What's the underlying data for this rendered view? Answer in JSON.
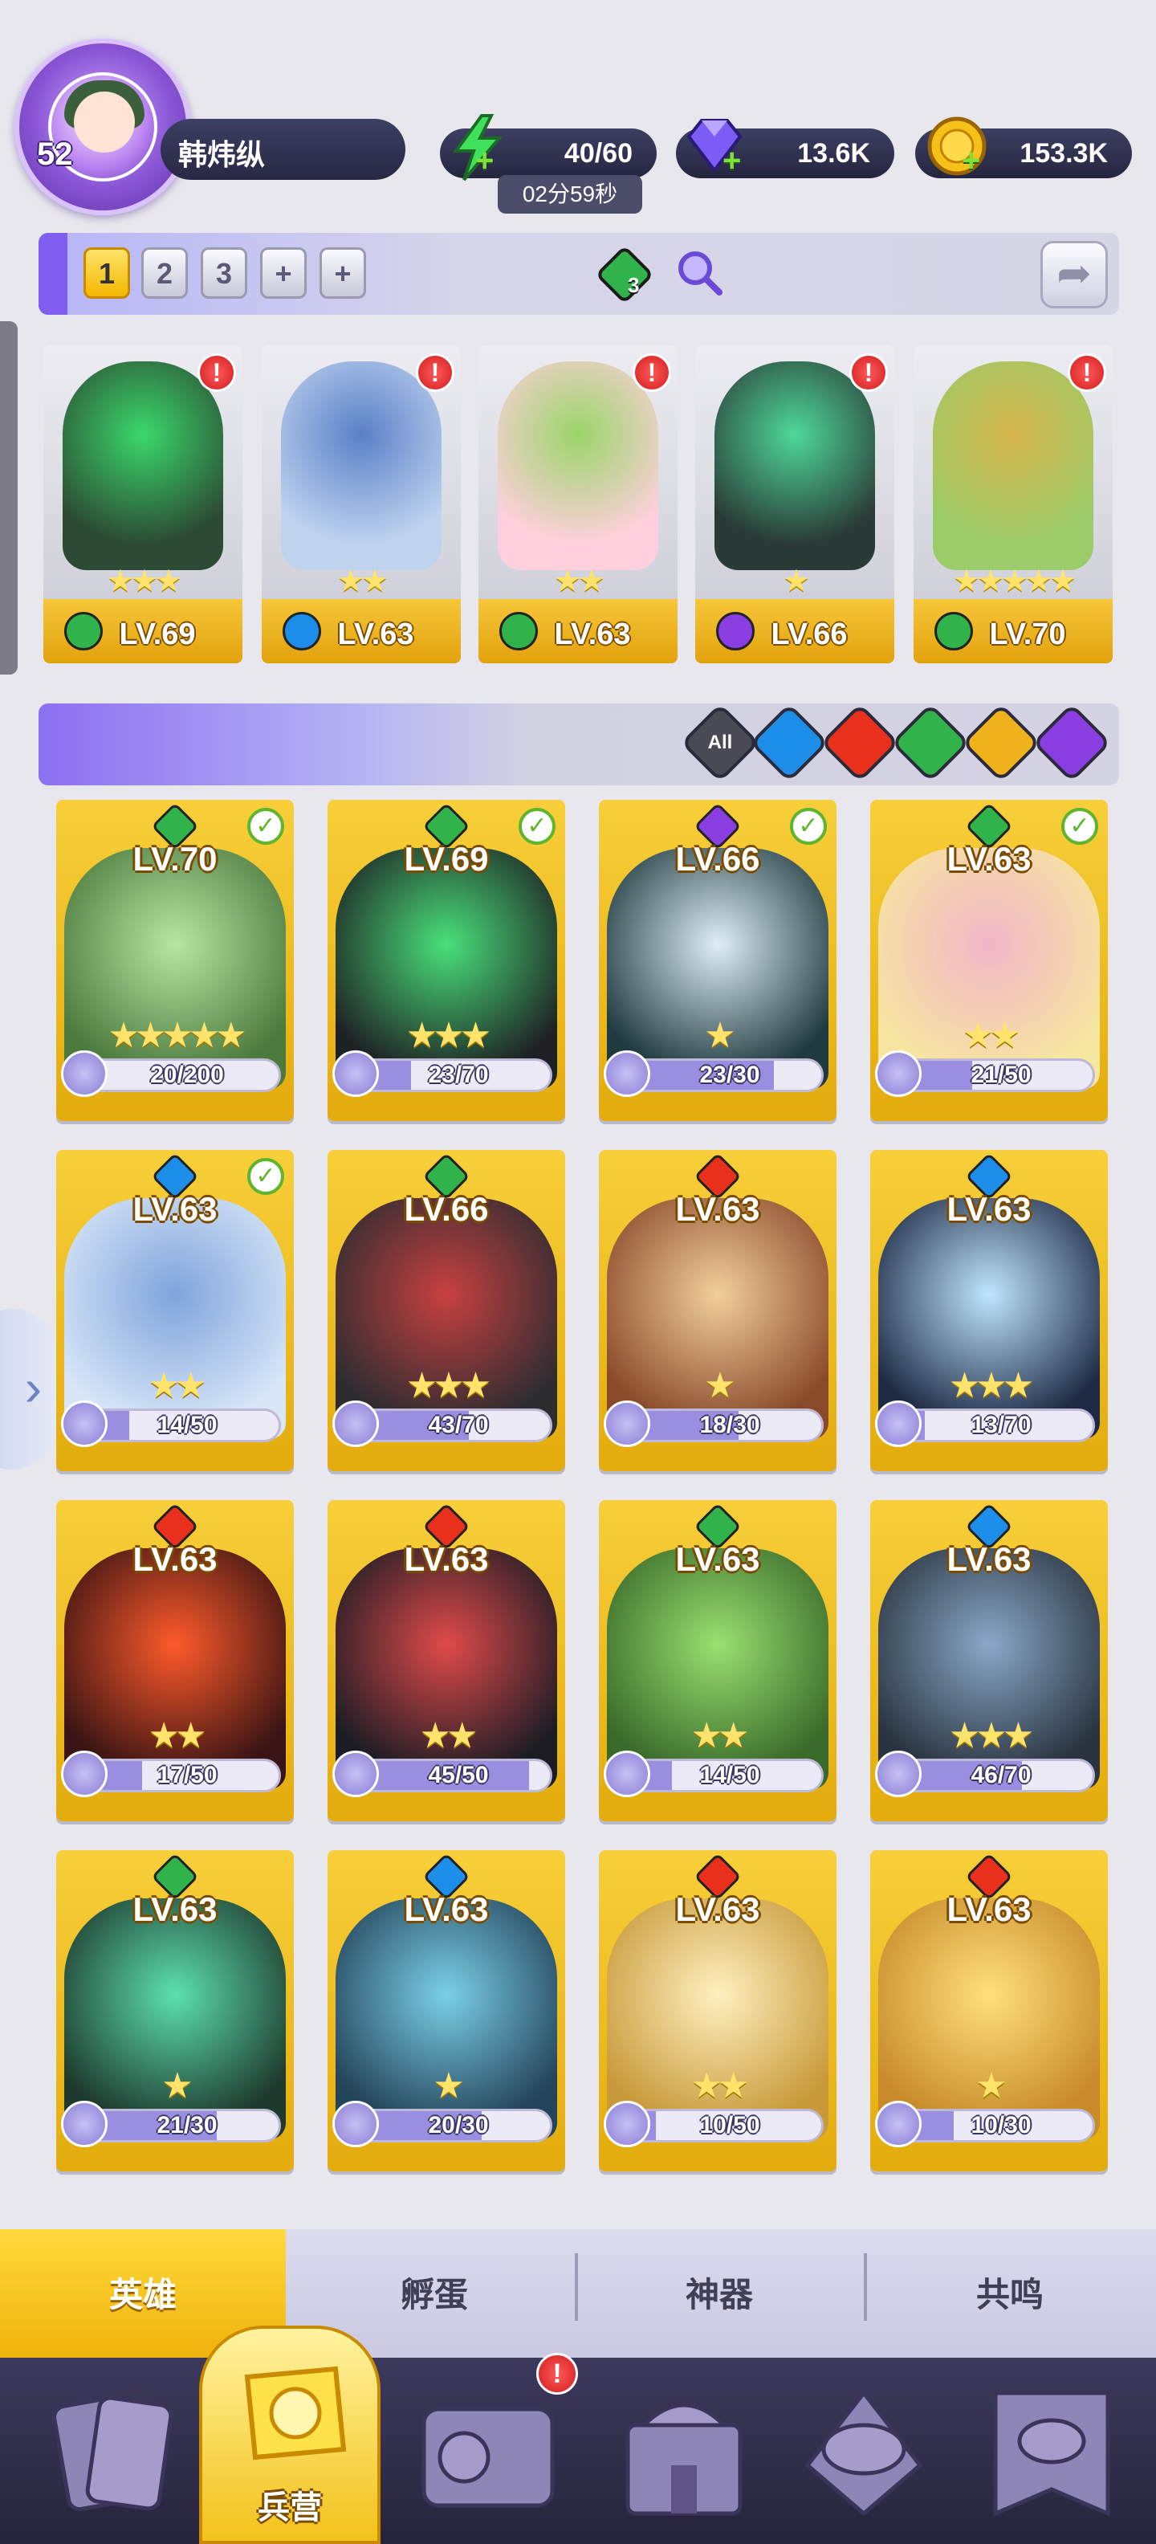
{
  "player": {
    "level": "52",
    "name": "韩炜纵"
  },
  "resources": {
    "energy": "40/60",
    "energy_timer": "02分59秒",
    "gems": "13.6K",
    "gold": "153.3K",
    "plus": "+"
  },
  "team": {
    "tabs": [
      "1",
      "2",
      "3",
      "+",
      "+"
    ],
    "active_tab": "1",
    "element_badge_count": "3",
    "slots": [
      {
        "level": "LV.69",
        "stars": "★★★",
        "element": "nature",
        "alert": "!"
      },
      {
        "level": "LV.63",
        "stars": "★★",
        "element": "water",
        "alert": "!"
      },
      {
        "level": "LV.63",
        "stars": "★★",
        "element": "nature",
        "alert": "!"
      },
      {
        "level": "LV.66",
        "stars": "★",
        "element": "dark",
        "alert": "!"
      },
      {
        "level": "LV.70",
        "stars": "★★★★★",
        "element": "nature",
        "alert": "!"
      }
    ]
  },
  "filters": [
    {
      "name": "all",
      "label": "All",
      "color": "#4a4a55"
    },
    {
      "name": "water",
      "label": "",
      "color": "#1c8de8"
    },
    {
      "name": "fire",
      "label": "",
      "color": "#e8301c"
    },
    {
      "name": "nature",
      "label": "",
      "color": "#2fb34a"
    },
    {
      "name": "light",
      "label": "",
      "color": "#f0b21a"
    },
    {
      "name": "dark",
      "label": "",
      "color": "#8a3de0"
    }
  ],
  "heroes": [
    {
      "level": "LV.70",
      "shards": "20/200",
      "shard_fraction": 0.1,
      "stars": "★★★★★",
      "element": "nature",
      "selected": true
    },
    {
      "level": "LV.69",
      "shards": "23/70",
      "shard_fraction": 0.33,
      "stars": "★★★",
      "element": "nature",
      "selected": true
    },
    {
      "level": "LV.66",
      "shards": "23/30",
      "shard_fraction": 0.77,
      "stars": "★",
      "element": "dark",
      "selected": true
    },
    {
      "level": "LV.63",
      "shards": "21/50",
      "shard_fraction": 0.42,
      "stars": "★★",
      "element": "nature",
      "selected": true
    },
    {
      "level": "LV.63",
      "shards": "14/50",
      "shard_fraction": 0.28,
      "stars": "★★",
      "element": "water",
      "selected": true
    },
    {
      "level": "LV.66",
      "shards": "43/70",
      "shard_fraction": 0.61,
      "stars": "★★★",
      "element": "nature",
      "selected": false
    },
    {
      "level": "LV.63",
      "shards": "18/30",
      "shard_fraction": 0.6,
      "stars": "★",
      "element": "fire",
      "selected": false
    },
    {
      "level": "LV.63",
      "shards": "13/70",
      "shard_fraction": 0.19,
      "stars": "★★★",
      "element": "water",
      "selected": false
    },
    {
      "level": "LV.63",
      "shards": "17/50",
      "shard_fraction": 0.34,
      "stars": "★★",
      "element": "fire",
      "selected": false
    },
    {
      "level": "LV.63",
      "shards": "45/50",
      "shard_fraction": 0.9,
      "stars": "★★",
      "element": "fire",
      "selected": false
    },
    {
      "level": "LV.63",
      "shards": "14/50",
      "shard_fraction": 0.28,
      "stars": "★★",
      "element": "nature",
      "selected": false
    },
    {
      "level": "LV.63",
      "shards": "46/70",
      "shard_fraction": 0.66,
      "stars": "★★★",
      "element": "water",
      "selected": false
    },
    {
      "level": "LV.63",
      "shards": "21/30",
      "shard_fraction": 0.7,
      "stars": "★",
      "element": "nature",
      "selected": false
    },
    {
      "level": "LV.63",
      "shards": "20/30",
      "shard_fraction": 0.67,
      "stars": "★",
      "element": "water",
      "selected": false
    },
    {
      "level": "LV.63",
      "shards": "10/50",
      "shard_fraction": 0.2,
      "stars": "★★",
      "element": "fire",
      "selected": false
    },
    {
      "level": "LV.63",
      "shards": "10/30",
      "shard_fraction": 0.33,
      "stars": "★",
      "element": "fire",
      "selected": false
    }
  ],
  "element_colors": {
    "nature": "#2fb34a",
    "water": "#1c8de8",
    "fire": "#e8301c",
    "dark": "#8a3de0",
    "light": "#f0b21a"
  },
  "subtabs": [
    "英雄",
    "孵蛋",
    "神器",
    "共鸣"
  ],
  "navbar": {
    "active_label": "兵营",
    "alert": "!"
  },
  "check_mark": "✓"
}
